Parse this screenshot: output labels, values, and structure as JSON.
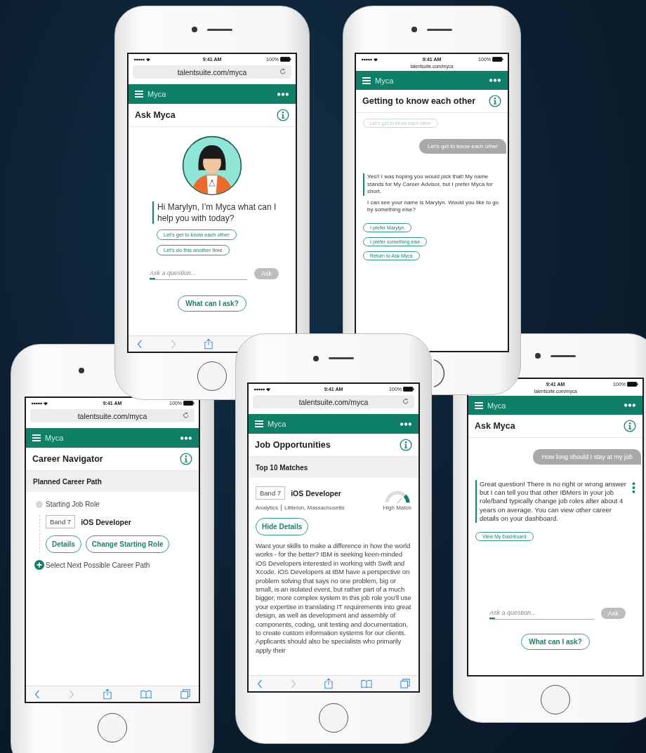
{
  "phones": [
    {
      "status_bar": {
        "time": "9:41 AM",
        "battery": "100%"
      },
      "address": {
        "kind": "field",
        "url": "talentsuite.com/myca"
      },
      "app_bar": {
        "title": "Myca"
      },
      "page_title": "Ask Myca",
      "blocks": [
        {
          "kind": "picture"
        },
        {
          "kind": "greeting",
          "text": "Hi Marylyn, I’m Myca what can I help you with today?"
        },
        {
          "kind": "chips",
          "items": [
            {
              "label": "Let’s get to know each other",
              "disabled": false
            },
            {
              "label": "Let’s do this another time",
              "disabled": false
            }
          ]
        },
        {
          "kind": "ask_input",
          "placeholder": "Ask a question...",
          "button": "Ask"
        },
        {
          "kind": "help_button",
          "label": "What can I ask?"
        }
      ]
    },
    {
      "status_bar": {
        "time": "9:41 AM",
        "battery": "100%"
      },
      "address": {
        "kind": "compact",
        "url": "talentsuite.com/myca"
      },
      "app_bar": {
        "title": "Myca"
      },
      "page_title": "Getting to know each other",
      "blocks": [
        {
          "kind": "chips",
          "items": [
            {
              "label": "Let’s get to know each other",
              "disabled": true
            }
          ]
        },
        {
          "kind": "user_bubble",
          "text": "Let’s get to know each other"
        },
        {
          "kind": "bot_message",
          "menu": false,
          "paragraphs": [
            "Yes!! I was hoping you would pick that! My name stands for My Career Advisor, but  I prefer Myca for short.",
            "I can see your name is Marylyn. Would you like to go by something else?"
          ]
        },
        {
          "kind": "chips",
          "items": [
            {
              "label": "I prefer Marylyn",
              "disabled": false
            },
            {
              "label": "I prefer something else",
              "disabled": false
            },
            {
              "label": "Return to Ask Myca",
              "disabled": false
            }
          ]
        }
      ]
    },
    {
      "status_bar": {
        "time": "9:41 AM",
        "battery": "100%"
      },
      "address": {
        "kind": "field",
        "url": "talentsuite.com/myca"
      },
      "app_bar": {
        "title": "Myca"
      },
      "page_title": "Career Navigator",
      "blocks": [
        {
          "kind": "section_header",
          "label": "Planned Career Path"
        },
        {
          "kind": "career_path",
          "start_label": "Starting Job Role",
          "band": "Band 7",
          "role": "iOS Developer",
          "buttons": [
            "Details",
            "Change Starting Role"
          ],
          "next_label": "Select Next Possible Career Path"
        }
      ]
    },
    {
      "status_bar": {
        "time": "9:41 AM",
        "battery": "100%"
      },
      "address": {
        "kind": "field",
        "url": "talentsuite.com/myca"
      },
      "app_bar": {
        "title": "Myca"
      },
      "page_title": "Job Opportunities",
      "blocks": [
        {
          "kind": "section_header",
          "label": "Top 10 Matches"
        },
        {
          "kind": "job_card",
          "band": "Band 7",
          "role": "iOS Developer",
          "department": "Analytics",
          "location": "Littleton, Massachusetts",
          "match": {
            "label": "High Match"
          },
          "button": "Hide Details",
          "description": "Want your skills to make a difference in how the world works - for the better? IBM is seeking keen-minded iOS Developers interested in working with Swift and Xcode. iOS Developers at IBM have a perspective on problem solving that says no one problem, big or small, is an isolated event, but rather part of a much bigger, more complex system In this job role you’ll use your expertise in translating IT requirements into great design, as well as development and assembly of components, coding, unit testing and documentation, to create custom information systems for our clients. Applicants should also be specialists who primarily apply their"
        }
      ]
    },
    {
      "status_bar": {
        "time": "9:41 AM",
        "battery": "100%"
      },
      "address": {
        "kind": "compact",
        "url": "talentsuite.com/myca"
      },
      "app_bar": {
        "title": "Myca"
      },
      "page_title": "Ask Myca",
      "blocks": [
        {
          "kind": "user_bubble",
          "text": "How long should I stay at my job"
        },
        {
          "kind": "bot_message",
          "menu": true,
          "paragraphs": [
            "Great question! There is no right or wrong answer but I can tell you that other IBMers in your job role/band typically change job roles after about 4 years on average. You can view other career details on your dashboard."
          ]
        },
        {
          "kind": "chips",
          "items": [
            {
              "label": "View My Dashboard",
              "disabled": false
            }
          ]
        },
        {
          "kind": "ask_input",
          "placeholder": "Ask a question...",
          "button": "Ask"
        },
        {
          "kind": "help_button",
          "label": "What can I ask?"
        }
      ]
    }
  ]
}
